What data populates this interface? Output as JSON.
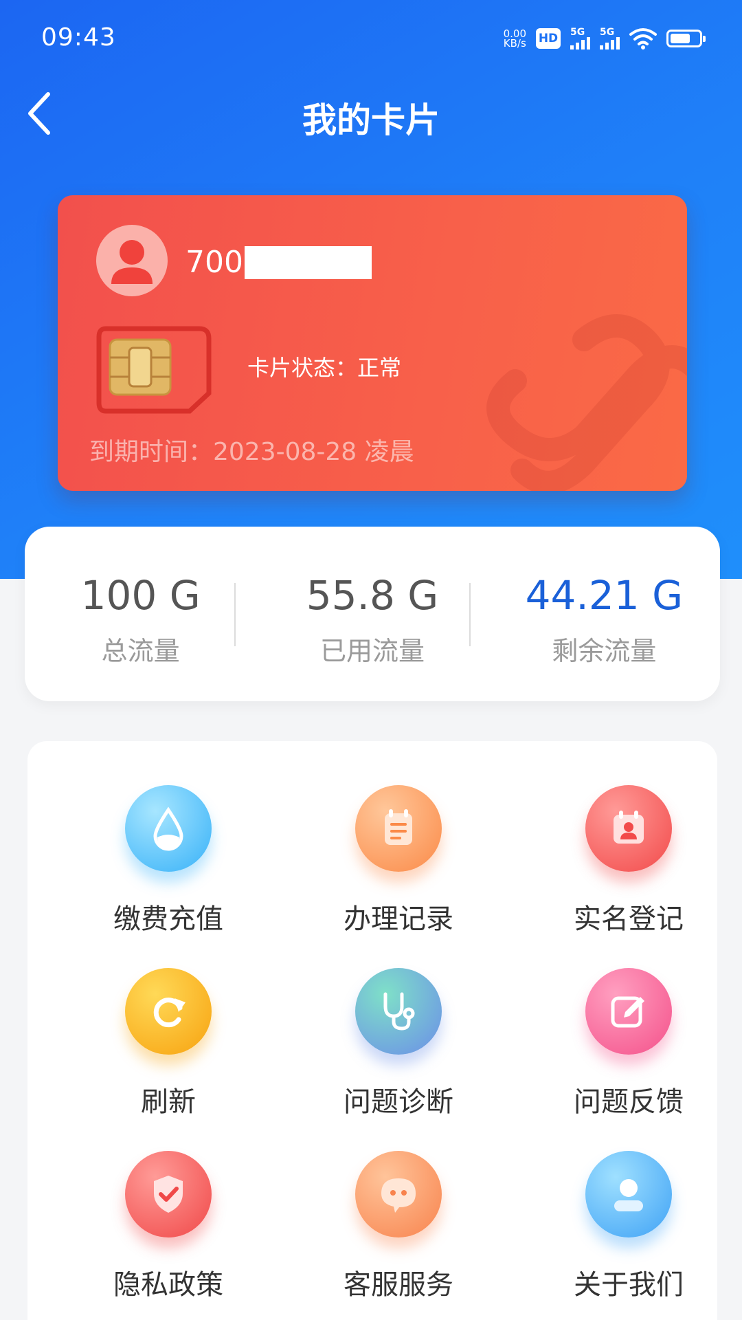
{
  "status_bar": {
    "time": "09:43",
    "net_speed_value": "0.00",
    "net_speed_unit": "KB/s",
    "hd_label": "HD",
    "signal1_label": "5G",
    "signal2_label": "5G",
    "icons": [
      "hd-icon",
      "signal-5g-icon",
      "signal-5g-icon",
      "wifi-icon",
      "battery-icon"
    ]
  },
  "header": {
    "title": "我的卡片",
    "back_icon": "chevron-left-icon"
  },
  "card": {
    "number_prefix": "700",
    "status_text": "卡片状态：正常",
    "expiry_text": "到期时间：2023-08-28 凌晨",
    "colors": {
      "card_bg": "#f55a4a"
    }
  },
  "data_usage": {
    "total_value": "100 G",
    "total_label": "总流量",
    "used_value": "55.8 G",
    "used_label": "已用流量",
    "remaining_value": "44.21 G",
    "remaining_label": "剩余流量",
    "accent_color": "#1a60d8"
  },
  "services": [
    {
      "label": "缴费充值",
      "icon": "water-drop-icon"
    },
    {
      "label": "办理记录",
      "icon": "notepad-icon"
    },
    {
      "label": "实名登记",
      "icon": "id-card-icon"
    },
    {
      "label": "刷新",
      "icon": "refresh-icon"
    },
    {
      "label": "问题诊断",
      "icon": "stethoscope-icon"
    },
    {
      "label": "问题反馈",
      "icon": "edit-icon"
    },
    {
      "label": "隐私政策",
      "icon": "shield-check-icon"
    },
    {
      "label": "客服服务",
      "icon": "chat-bubble-icon"
    },
    {
      "label": "关于我们",
      "icon": "user-icon"
    }
  ]
}
